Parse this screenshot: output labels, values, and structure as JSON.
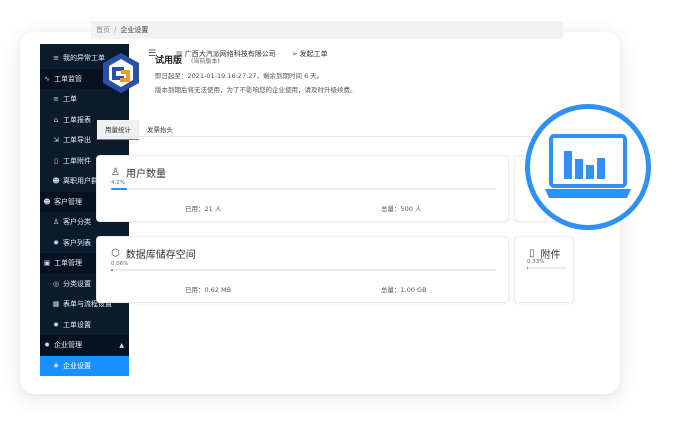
{
  "sidebar": {
    "items": [
      {
        "kind": "item",
        "icon": "list-icon",
        "glyph": "≡",
        "label": "我的异常工单"
      },
      {
        "kind": "group",
        "icon": "monitor-icon",
        "glyph": "∿",
        "label": "工单监管"
      },
      {
        "kind": "item",
        "icon": "list-icon",
        "glyph": "≡",
        "label": "工单"
      },
      {
        "kind": "item",
        "icon": "home-icon",
        "glyph": "⌂",
        "label": "工单报表"
      },
      {
        "kind": "item",
        "icon": "export-icon",
        "glyph": "⇲",
        "label": "工单导出"
      },
      {
        "kind": "item",
        "icon": "file-icon",
        "glyph": "▯",
        "label": "工单附件"
      },
      {
        "kind": "item",
        "icon": "users-icon",
        "glyph": "☻",
        "label": "离职用户群"
      },
      {
        "kind": "group",
        "icon": "users-icon",
        "glyph": "☻",
        "label": "客户管理"
      },
      {
        "kind": "item",
        "icon": "user-icon",
        "glyph": "♙",
        "label": "客户分类"
      },
      {
        "kind": "item",
        "icon": "gear-icon",
        "glyph": "✹",
        "label": "客户列表"
      },
      {
        "kind": "group",
        "icon": "ticket-icon",
        "glyph": "▣",
        "label": "工单管理"
      },
      {
        "kind": "item",
        "icon": "category-icon",
        "glyph": "◎",
        "label": "分类设置"
      },
      {
        "kind": "item",
        "icon": "form-icon",
        "glyph": "▦",
        "label": "表单与流程设置"
      },
      {
        "kind": "item",
        "icon": "gear-icon",
        "glyph": "✹",
        "label": "工单设置"
      },
      {
        "kind": "group",
        "icon": "gear-icon",
        "glyph": "✹",
        "label": "企业管理"
      },
      {
        "kind": "item",
        "icon": "gear-icon",
        "glyph": "✹",
        "label": "企业设置",
        "active": true
      }
    ]
  },
  "topbar": {
    "company": "广西大汽派网络科技有限公司",
    "send_ticket": "发起工单"
  },
  "breadcrumb": {
    "home": "首页",
    "sep": "/",
    "current": "企业设置"
  },
  "plan": {
    "title": "试用版",
    "tag": "(当前版本)",
    "expire": "即日起至：2021-01-19 16:27:27，剩余到期时间 6 天。",
    "note": "版本到期后将无法使用，为了不影响您的企业使用，请及时升级续费。"
  },
  "tabs": [
    "用量统计",
    "发票抬头"
  ],
  "stats": {
    "users": {
      "title": "用户数量",
      "percent": "4.2%",
      "fraction": 0.042,
      "used": "已用：21 人",
      "total": "总量：500 人"
    },
    "storage": {
      "title": "数据库储存空间",
      "percent": "0.06%",
      "fraction": 0.0006,
      "used": "已用：0.62 MB",
      "total": "总量：1.00 GB"
    },
    "attachments": {
      "title": "附件",
      "percent": "0.33%",
      "fraction": 0.0033
    }
  },
  "colors": {
    "accent": "#1890ff",
    "sidebar": "#0b1b2e",
    "circle": "#2f90f5"
  }
}
